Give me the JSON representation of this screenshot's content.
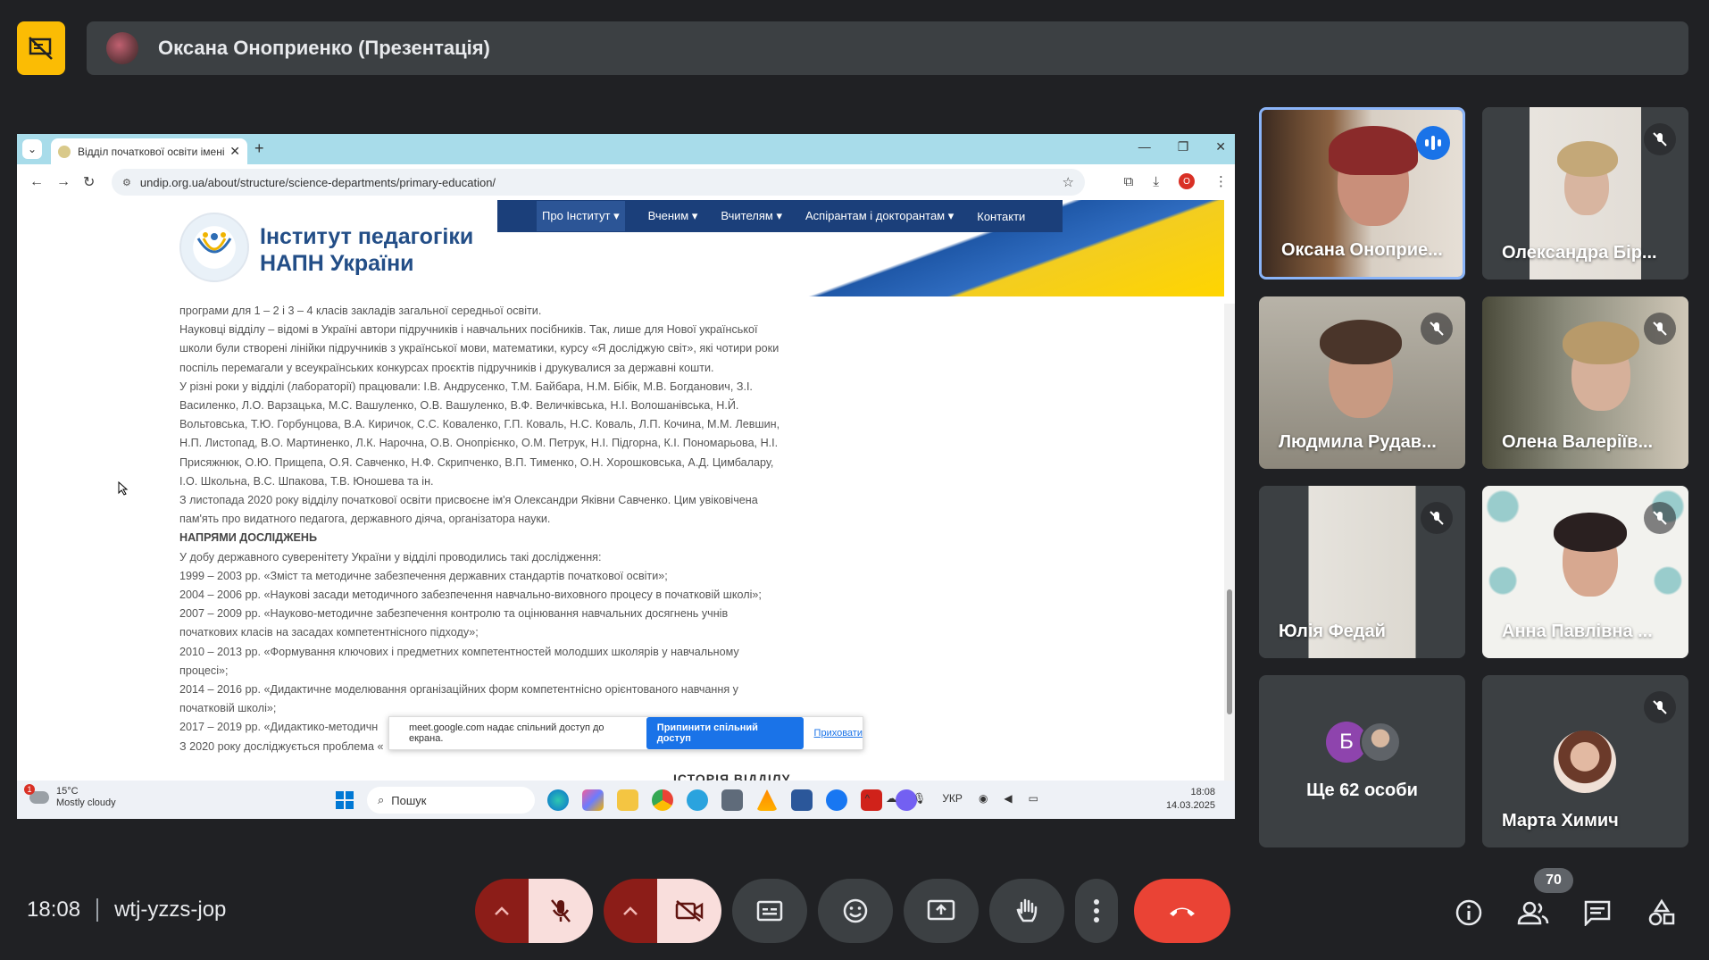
{
  "presenter_bar": {
    "title": "Оксана Оноприенко (Презентація)"
  },
  "browser": {
    "tab_title": "Відділ початкової освіти імені",
    "new_tab": "+",
    "url": "undip.org.ua/about/structure/science-departments/primary-education/"
  },
  "site": {
    "logo_line1": "Інститут педагогіки",
    "logo_line2": "НАПН України",
    "nav": [
      "Про Інститут ▾",
      "Вченим ▾",
      "Вчителям ▾",
      "Аспірантам і докторантам ▾",
      "Контакти"
    ]
  },
  "article": {
    "lines": [
      "програми для 1 – 2 і 3 – 4 класів закладів загальної середньої освіти.",
      "Науковці відділу – відомі в Україні автори підручників і навчальних посібників. Так, лише для Нової української",
      "школи були створені лінійки підручників з української мови, математики, курсу «Я досліджую світ», які чотири роки",
      "поспіль перемагали у всеукраїнських конкурсах проєктів підручників і друкувалися за державні кошти.",
      "У різні роки у відділі (лабораторії) працювали: І.В. Андрусенко, Т.М. Байбара, Н.М. Бібік, М.В. Богданович, З.І.",
      "Василенко, Л.О. Варзацька, М.С. Вашуленко, О.В. Вашуленко, В.Ф. Величківська, Н.І. Волошанівська, Н.Й.",
      "Вольтовська, Т.Ю. Горбунцова, В.А. Киричок, С.С. Коваленко, Г.П. Коваль, Н.С. Коваль, Л.П. Кочина, М.М. Левшин,",
      "Н.П. Листопад, В.О. Мартиненко, Л.К. Нарочна, О.В. Онопрієнко, О.М. Петрук, Н.І. Підгорна, К.І. Пономарьова, Н.І.",
      "Присяжнюк, О.Ю. Прищепа, О.Я. Савченко, Н.Ф. Скрипченко, В.П. Тименко, О.Н. Хорошковська, А.Д. Цимбалару,",
      "І.О. Школьна, В.С. Шпакова, Т.В. Юношева та ін.",
      "З листопада 2020 року відділу початкової освіти присвоєне ім'я Олександри Яківни Савченко. Цим увіковічена",
      "пам'ять про видатного педагога, державного діяча, організатора науки."
    ],
    "heading": "НАПРЯМИ ДОСЛІДЖЕНЬ",
    "lines2": [
      "У добу державного суверенітету України у відділі проводились такі дослідження:",
      "1999 – 2003 рр. «Зміст та методичне забезпечення державних стандартів початкової освіти»;",
      "2004 – 2006 рр. «Наукові засади методичного забезпечення навчально-виховного процесу в початковій школі»;",
      "2007 – 2009 рр. «Науково-методичне забезпечення контролю та оцінювання навчальних досягнень учнів",
      "початкових класів на засадах компетентнісного підходу»;",
      "2010 – 2013 рр. «Формування ключових і предметних компетентностей молодших школярів у навчальному",
      "процесі»;",
      "2014 – 2016 рр. «Дидактичне моделювання організаційних форм компетентнісно орієнтованого навчання у",
      "початковій школі»;",
      "2017 – 2019 рр. «Дидактико-методичн",
      "З 2020 року досліджується проблема «"
    ],
    "history_heading": "ІСТОРІЯ ВІДДІЛУ"
  },
  "share_notice": {
    "text": "meet.google.com надає спільний доступ до екрана.",
    "stop": "Припинити спільний доступ",
    "hide": "Приховати"
  },
  "taskbar": {
    "temp": "15°C",
    "weather": "Mostly cloudy",
    "search_placeholder": "Пошук",
    "lang": "УКР",
    "time": "18:08",
    "date": "14.03.2025"
  },
  "participants": [
    {
      "name": "Оксана Оноприе...",
      "state": "speaking"
    },
    {
      "name": "Олександра Бір...",
      "state": "muted"
    },
    {
      "name": "Людмила Рудав...",
      "state": "muted"
    },
    {
      "name": "Олена Валеріїв...",
      "state": "muted"
    },
    {
      "name": "Юлія Федай",
      "state": "muted"
    },
    {
      "name": "Анна Павлівна ...",
      "state": "muted"
    },
    {
      "name": "Ще 62 особи",
      "avatar_letter": "Б"
    },
    {
      "name": "Марта Химич",
      "state": "muted"
    }
  ],
  "bottom_bar": {
    "time": "18:08",
    "meeting_code": "wtj-yzzs-jop",
    "people_count": "70"
  },
  "colors": {
    "background": "#202124",
    "tile": "#3c4043",
    "accent": "#8ab4f8",
    "present": "#fbbc04",
    "end_call": "#ea4335",
    "mic_off": "#f9dedc"
  }
}
